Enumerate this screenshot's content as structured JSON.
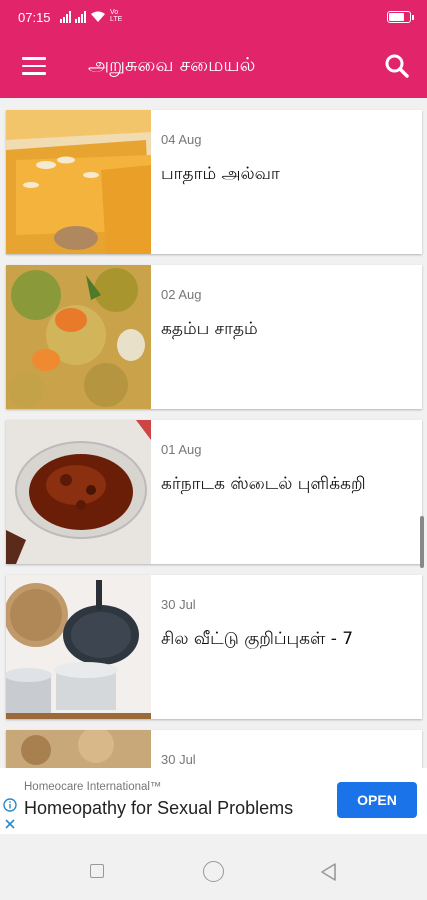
{
  "status_bar": {
    "time": "07:15",
    "network": "Vo LTE",
    "battery_level": 0.85
  },
  "app_bar": {
    "title": "அறுசுவை சமையல்",
    "menu_icon": "menu-icon",
    "search_icon": "search-icon"
  },
  "recipes": [
    {
      "date": "04 Aug",
      "title": "பாதாம் அல்வா",
      "image": "badam-halwa-thumbnail"
    },
    {
      "date": "02 Aug",
      "title": "கதம்ப சாதம்",
      "image": "kadamba-sadam-thumbnail"
    },
    {
      "date": "01 Aug",
      "title": "கர்நாடக ஸ்டைல் புளிக்கறி",
      "image": "karnataka-pulikari-thumbnail"
    },
    {
      "date": "30 Jul",
      "title": "சில வீட்டு குறிப்புகள் - 7",
      "image": "kitchen-cookware-thumbnail"
    },
    {
      "date": "30 Jul",
      "title": "",
      "image": "rice-dish-thumbnail"
    }
  ],
  "ad": {
    "advertiser": "Homeocare International™",
    "headline": "Homeopathy for Sexual Problems",
    "cta": "OPEN",
    "cta_color": "#1a73e8"
  },
  "colors": {
    "primary": "#e2246b",
    "background": "#f1f1f1"
  }
}
